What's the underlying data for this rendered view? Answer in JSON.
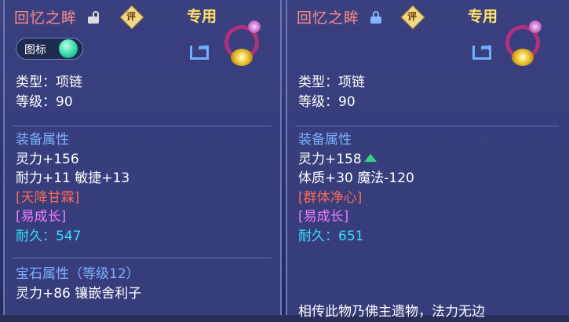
{
  "left": {
    "title": "回忆之眸",
    "lock_icon": "unlocked-icon",
    "review_badge": "评",
    "exclusive": "专用",
    "toggle_label": "图标",
    "type_line": "类型：项链",
    "level_line": "等级：90",
    "equip_heading": "装备属性",
    "stat1": "灵力+156",
    "stat2": "耐力+11 敏捷+13",
    "special_skill": "[天降甘霖]",
    "special_effect": "[易成长]",
    "durability_label": "耐久：",
    "durability_value": "547",
    "gem_heading": "宝石属性（等级12）",
    "gem_line": "灵力+86 镶嵌舍利子"
  },
  "right": {
    "title": "回忆之眸",
    "lock_icon": "locked-icon",
    "review_badge": "评",
    "exclusive": "专用",
    "type_line": "类型：项链",
    "level_line": "等级：90",
    "equip_heading": "装备属性",
    "stat1": "灵力+158",
    "stat2": "体质+30 魔法-120",
    "special_skill": "[群体净心]",
    "special_effect": "[易成长]",
    "durability_label": "耐久：",
    "durability_value": "651",
    "lore": "相传此物乃佛主遗物，法力无边"
  },
  "colors": {
    "title": "#ff8a8a",
    "exclusive": "#ffe066",
    "heading": "#7fb0ff",
    "skill": "#ff6a55",
    "effect": "#f07aff",
    "durability": "#36e0ff",
    "upgrade_arrow": "#2fd67a"
  }
}
